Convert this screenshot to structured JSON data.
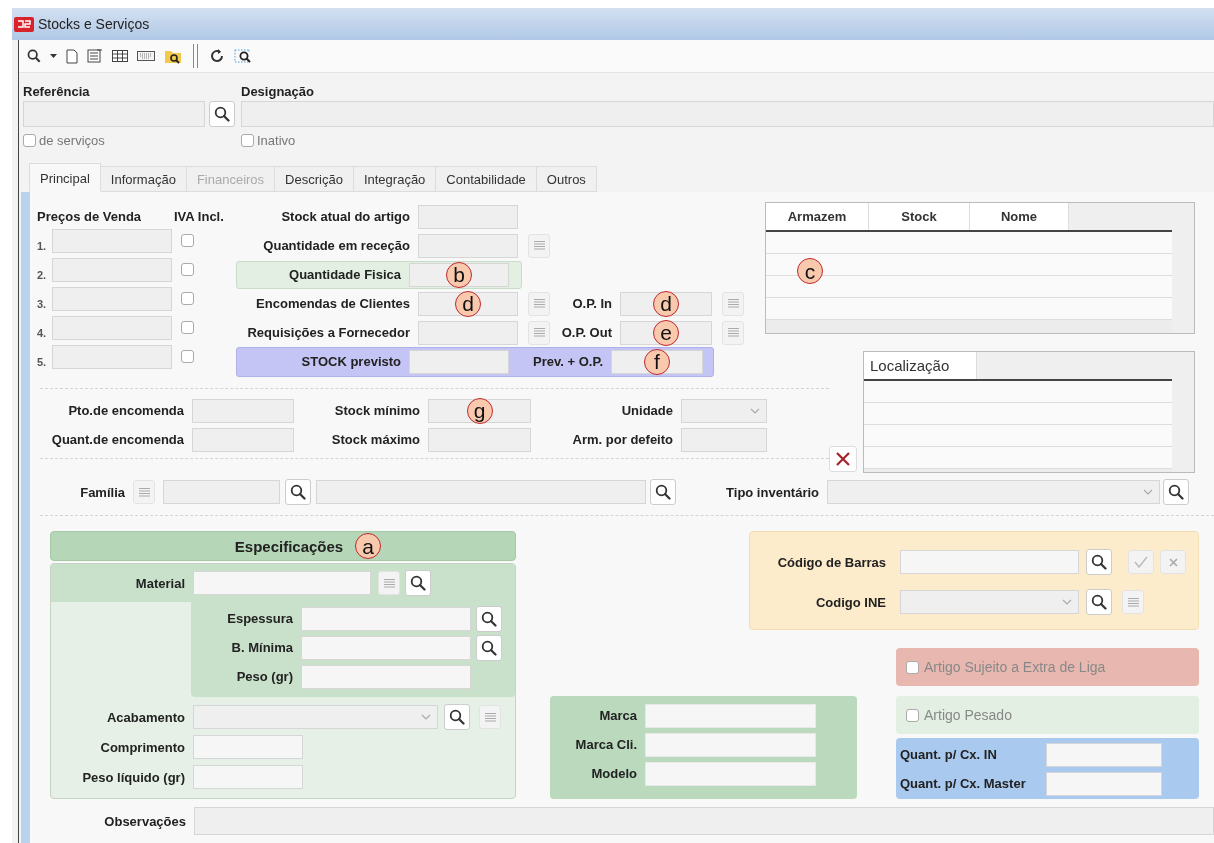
{
  "window": {
    "title": "Stocks e Serviços"
  },
  "header": {
    "reference_label": "Referência",
    "designation_label": "Designação",
    "checkboxes": [
      {
        "label": "de serviços",
        "checked": false
      },
      {
        "label": "Inativo",
        "checked": false
      }
    ]
  },
  "tabs": [
    {
      "label": "Principal",
      "selected": true,
      "disabled": false
    },
    {
      "label": "Informação",
      "selected": false,
      "disabled": false
    },
    {
      "label": "Financeiros",
      "selected": false,
      "disabled": true
    },
    {
      "label": "Descrição",
      "selected": false,
      "disabled": false
    },
    {
      "label": "Integração",
      "selected": false,
      "disabled": false
    },
    {
      "label": "Contabilidade",
      "selected": false,
      "disabled": false
    },
    {
      "label": "Outros",
      "selected": false,
      "disabled": false
    }
  ],
  "prices": {
    "title": "Preços de Venda",
    "vat_title": "IVA Incl.",
    "rows": [
      {
        "index": "1.",
        "vat_included": false
      },
      {
        "index": "2.",
        "vat_included": false
      },
      {
        "index": "3.",
        "vat_included": false
      },
      {
        "index": "4.",
        "vat_included": false
      },
      {
        "index": "5.",
        "vat_included": false
      }
    ]
  },
  "stock_rows": [
    {
      "kind": "plain",
      "label": "Stock atual do artigo"
    },
    {
      "kind": "list",
      "label": "Quantidade em receção"
    },
    {
      "kind": "highlight",
      "label": "Quantidade Fisica",
      "marker": "b"
    },
    {
      "kind": "list",
      "label": "Encomendas de Clientes",
      "marker": "d",
      "op": {
        "label": "O.P. In",
        "marker": "d"
      }
    },
    {
      "kind": "list",
      "label": "Requisições a Fornecedor",
      "op": {
        "label": "O.P. Out",
        "marker": "e"
      }
    },
    {
      "kind": "forecast",
      "label": "STOCK previsto",
      "op": {
        "label": "Prev. + O.P.",
        "marker": "f"
      }
    }
  ],
  "warehouse_table": {
    "columns": [
      "Armazem",
      "Stock",
      "Nome"
    ],
    "marker": "c"
  },
  "location_table": {
    "columns": [
      "Localização"
    ]
  },
  "order_rows": [
    [
      {
        "kind": "input",
        "label": "Pto.de encomenda"
      },
      {
        "kind": "input",
        "label": "Stock mínimo",
        "marker": "g"
      },
      {
        "kind": "select",
        "label": "Unidade"
      }
    ],
    [
      {
        "kind": "input",
        "label": "Quant.de encomenda"
      },
      {
        "kind": "input",
        "label": "Stock máximo"
      },
      {
        "kind": "input",
        "label": "Arm. por defeito"
      }
    ]
  ],
  "family": {
    "label": "Família",
    "inventory_label": "Tipo inventário"
  },
  "specifications": {
    "title": "Especificações",
    "marker": "a",
    "material_label": "Material",
    "sub_fields": [
      {
        "kind": "search",
        "label": "Espessura"
      },
      {
        "kind": "search",
        "label": "B. Mínima"
      },
      {
        "kind": "plain",
        "label": "Peso (gr)"
      }
    ],
    "finish_label": "Acabamento",
    "fields": [
      {
        "label": "Comprimento"
      },
      {
        "label": "Peso líquido (gr)"
      }
    ]
  },
  "brand_fields": [
    {
      "label": "Marca"
    },
    {
      "label": "Marca Cli."
    },
    {
      "label": "Modelo"
    }
  ],
  "codes": {
    "barcode_label": "Código de Barras",
    "ine_label": "Codigo INE"
  },
  "flags": [
    {
      "label": "Artigo Sujeito a Extra de Liga",
      "checked": false,
      "color": "#e8b8b0"
    },
    {
      "label": "Artigo Pesado",
      "checked": false,
      "color": "#e2efe2"
    }
  ],
  "box_fields": [
    {
      "label": "Quant. p/ Cx. IN"
    },
    {
      "label": "Quant. p/ Cx. Master"
    }
  ],
  "notes": {
    "label": "Observações"
  }
}
